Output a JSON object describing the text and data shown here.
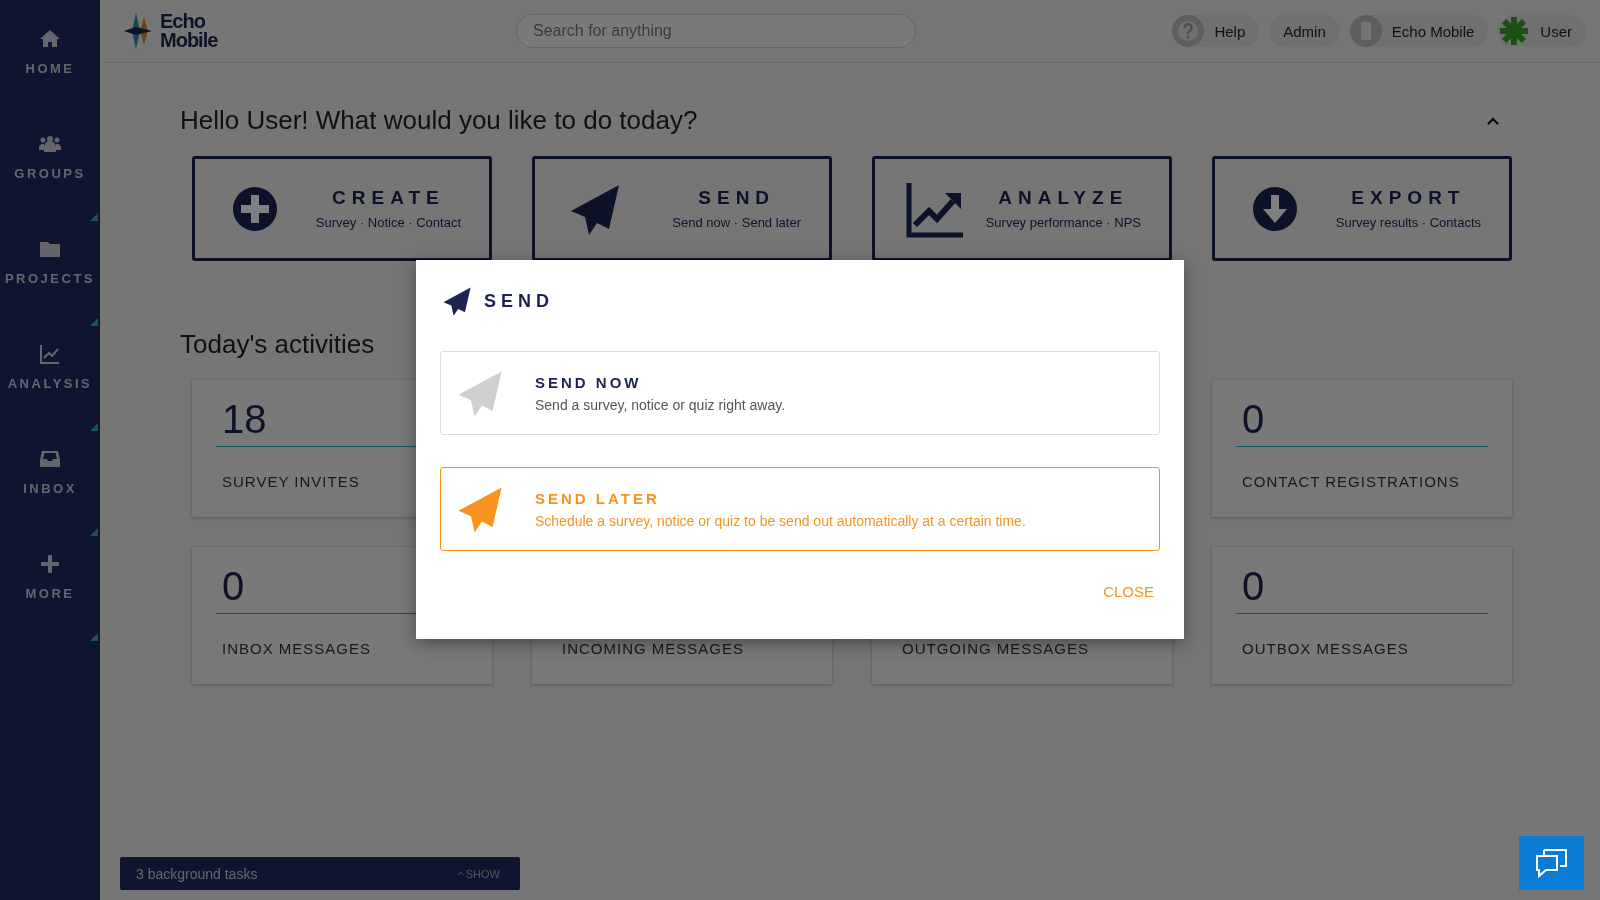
{
  "sidebar": {
    "items": [
      {
        "label": "HOME",
        "submenu": false
      },
      {
        "label": "GROUPS",
        "submenu": true
      },
      {
        "label": "PROJECTS",
        "submenu": true
      },
      {
        "label": "ANALYSIS",
        "submenu": true
      },
      {
        "label": "INBOX",
        "submenu": true
      },
      {
        "label": "MORE",
        "submenu": true
      }
    ]
  },
  "topbar": {
    "logo": [
      "Echo",
      "Mobile"
    ],
    "search": {
      "placeholder": "Search for anything"
    },
    "menu": [
      {
        "label": "Help"
      },
      {
        "label": "Admin"
      },
      {
        "label": "Echo Mobile"
      },
      {
        "label": "User"
      }
    ]
  },
  "greeting": "Hello User! What would you like to do today?",
  "actions": [
    {
      "title": "CREATE",
      "subtitle": "Survey · Notice · Contact"
    },
    {
      "title": "SEND",
      "subtitle": "Send now · Send later"
    },
    {
      "title": "ANALYZE",
      "subtitle": "Survey performance · NPS"
    },
    {
      "title": "EXPORT",
      "subtitle": "Survey results · Contacts"
    }
  ],
  "activities_heading": "Today's activities",
  "stats": [
    {
      "value": "18",
      "label": "SURVEY INVITES"
    },
    {
      "value": "0",
      "label": "CONTACT REGISTRATIONS"
    },
    {
      "value": "0",
      "label": "INBOX MESSAGES"
    },
    {
      "label": "INCOMING MESSAGES"
    },
    {
      "label": "OUTGOING MESSAGES"
    },
    {
      "value": "0",
      "label": "OUTBOX MESSAGES"
    }
  ],
  "modal": {
    "title": "SEND",
    "options": [
      {
        "title": "SEND NOW",
        "description": "Send a survey, notice or quiz right away.",
        "selected": false
      },
      {
        "title": "SEND LATER",
        "description": "Schedule a survey, notice or quiz to be send out automatically at a certain time.",
        "selected": true
      }
    ],
    "close": "CLOSE"
  },
  "background_tasks": {
    "text": "3 background tasks",
    "toggle": "SHOW"
  }
}
